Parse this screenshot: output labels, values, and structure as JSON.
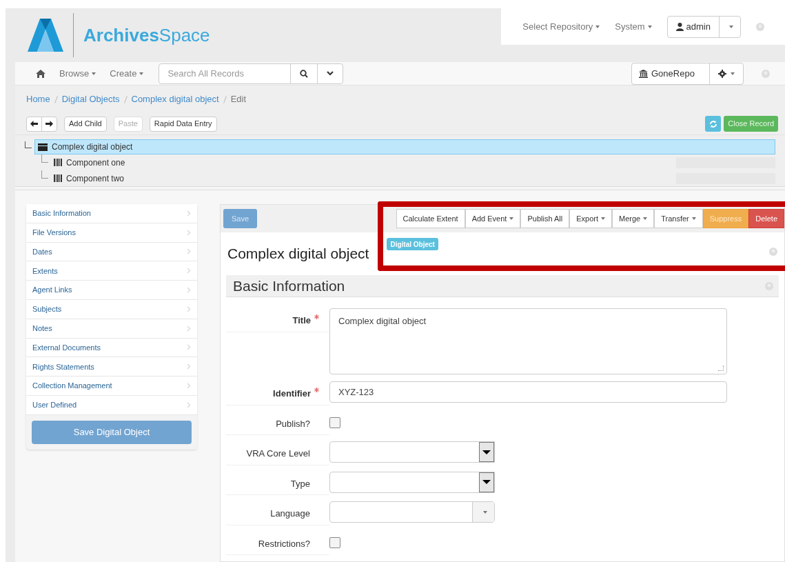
{
  "header": {
    "logo_text": "**Archives**Space",
    "menus": [
      {
        "label": "Select Repository"
      },
      {
        "label": "System"
      }
    ],
    "user": "admin"
  },
  "navbar": {
    "menus": [
      {
        "label": "Browse"
      },
      {
        "label": "Create"
      }
    ],
    "search": {
      "placeholder": "Search All Records"
    },
    "repository": "GoneRepo"
  },
  "breadcrumb": [
    {
      "label": "Home",
      "current": false
    },
    {
      "label": "Digital Objects",
      "current": false
    },
    {
      "label": "Complex digital object",
      "current": false
    },
    {
      "label": "Edit",
      "current": true
    }
  ],
  "toolbar": {
    "buttons": [
      {
        "label": "Add Child",
        "disabled": false
      },
      {
        "label": "Paste",
        "disabled": true
      },
      {
        "label": "Rapid Data Entry",
        "disabled": false
      }
    ],
    "close": "Close Record"
  },
  "tree": {
    "label": "Complex digital object",
    "selected": true,
    "children": [
      {
        "label": "Component one",
        "selected": false
      },
      {
        "label": "Component two",
        "selected": false
      }
    ]
  },
  "sidebar": {
    "items": [
      "Basic Information",
      "File Versions",
      "Dates",
      "Extents",
      "Agent Links",
      "Subjects",
      "Notes",
      "External Documents",
      "Rights Statements",
      "Collection Management",
      "User Defined"
    ],
    "save": "Save Digital Object"
  },
  "form": {
    "save": "Save",
    "actions": [
      {
        "label": "Calculate Extent",
        "kind": "default",
        "dropdown": false
      },
      {
        "label": "Add Event",
        "kind": "default",
        "dropdown": true
      },
      {
        "label": "Publish All",
        "kind": "default",
        "dropdown": false
      },
      {
        "label": "Export",
        "kind": "default",
        "dropdown": true
      },
      {
        "label": "Merge",
        "kind": "default",
        "dropdown": true
      },
      {
        "label": "Transfer",
        "kind": "default",
        "dropdown": true
      },
      {
        "label": "Suppress",
        "kind": "warning",
        "dropdown": false
      },
      {
        "label": "Delete",
        "kind": "danger",
        "dropdown": false
      }
    ],
    "title": "Complex digital object",
    "badge": "Digital Object",
    "section": "Basic Information",
    "fields": [
      {
        "label": "Title",
        "kind": "textarea",
        "required": true,
        "value": "Complex digital object"
      },
      {
        "label": "Identifier",
        "kind": "text",
        "required": true,
        "value": "XYZ-123"
      },
      {
        "label": "Publish?",
        "kind": "checkbox",
        "required": false,
        "checked": false
      },
      {
        "label": "VRA Core Level",
        "kind": "select",
        "required": false
      },
      {
        "label": "Type",
        "kind": "select",
        "required": false
      },
      {
        "label": "Language",
        "kind": "combobox",
        "required": false
      },
      {
        "label": "Restrictions?",
        "kind": "checkbox",
        "required": false,
        "checked": false
      }
    ]
  }
}
